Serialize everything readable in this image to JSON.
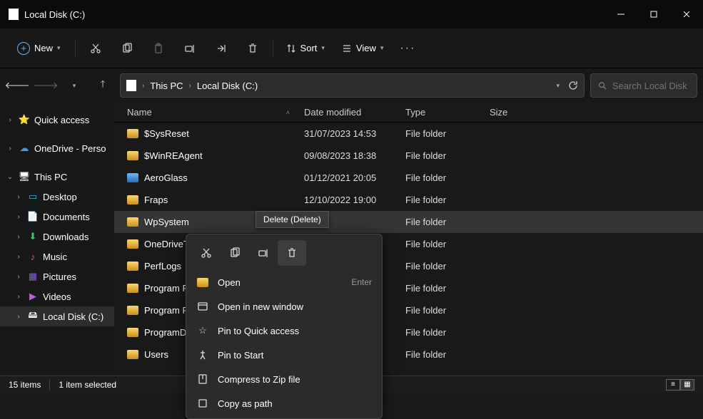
{
  "window": {
    "title": "Local Disk  (C:)"
  },
  "toolbar": {
    "new": "New",
    "sort": "Sort",
    "view": "View"
  },
  "breadcrumb": {
    "seg1": "This PC",
    "seg2": "Local Disk  (C:)"
  },
  "search": {
    "placeholder": "Search Local Disk  ..."
  },
  "sidebar": {
    "quick": "Quick access",
    "onedrive": "OneDrive - Perso",
    "thispc": "This PC",
    "desktop": "Desktop",
    "documents": "Documents",
    "downloads": "Downloads",
    "music": "Music",
    "pictures": "Pictures",
    "videos": "Videos",
    "localdisk": "Local Disk  (C:)"
  },
  "columns": {
    "name": "Name",
    "date": "Date modified",
    "type": "Type",
    "size": "Size"
  },
  "rows": [
    {
      "name": "$SysReset",
      "date": "31/07/2023 14:53",
      "type": "File folder"
    },
    {
      "name": "$WinREAgent",
      "date": "09/08/2023 18:38",
      "type": "File folder"
    },
    {
      "name": "AeroGlass",
      "date": "01/12/2021 20:05",
      "type": "File folder"
    },
    {
      "name": "Fraps",
      "date": "12/10/2022 19:00",
      "type": "File folder"
    },
    {
      "name": "WpSystem",
      "date": "",
      "type": "File folder"
    },
    {
      "name": "OneDriveTe",
      "date": "",
      "type": "File folder"
    },
    {
      "name": "PerfLogs",
      "date": "",
      "type": "File folder"
    },
    {
      "name": "Program File",
      "date": "",
      "type": "File folder"
    },
    {
      "name": "Program File",
      "date": "",
      "type": "File folder"
    },
    {
      "name": "ProgramDat",
      "date": "",
      "type": "File folder"
    },
    {
      "name": "Users",
      "date": "",
      "type": "File folder"
    }
  ],
  "tooltip": "Delete (Delete)",
  "context": {
    "open": "Open",
    "open_hint": "Enter",
    "open_new": "Open in new window",
    "pin_quick": "Pin to Quick access",
    "pin_start": "Pin to Start",
    "compress": "Compress to Zip file",
    "copy_path": "Copy as path"
  },
  "status": {
    "items": "15 items",
    "selected": "1 item selected"
  }
}
